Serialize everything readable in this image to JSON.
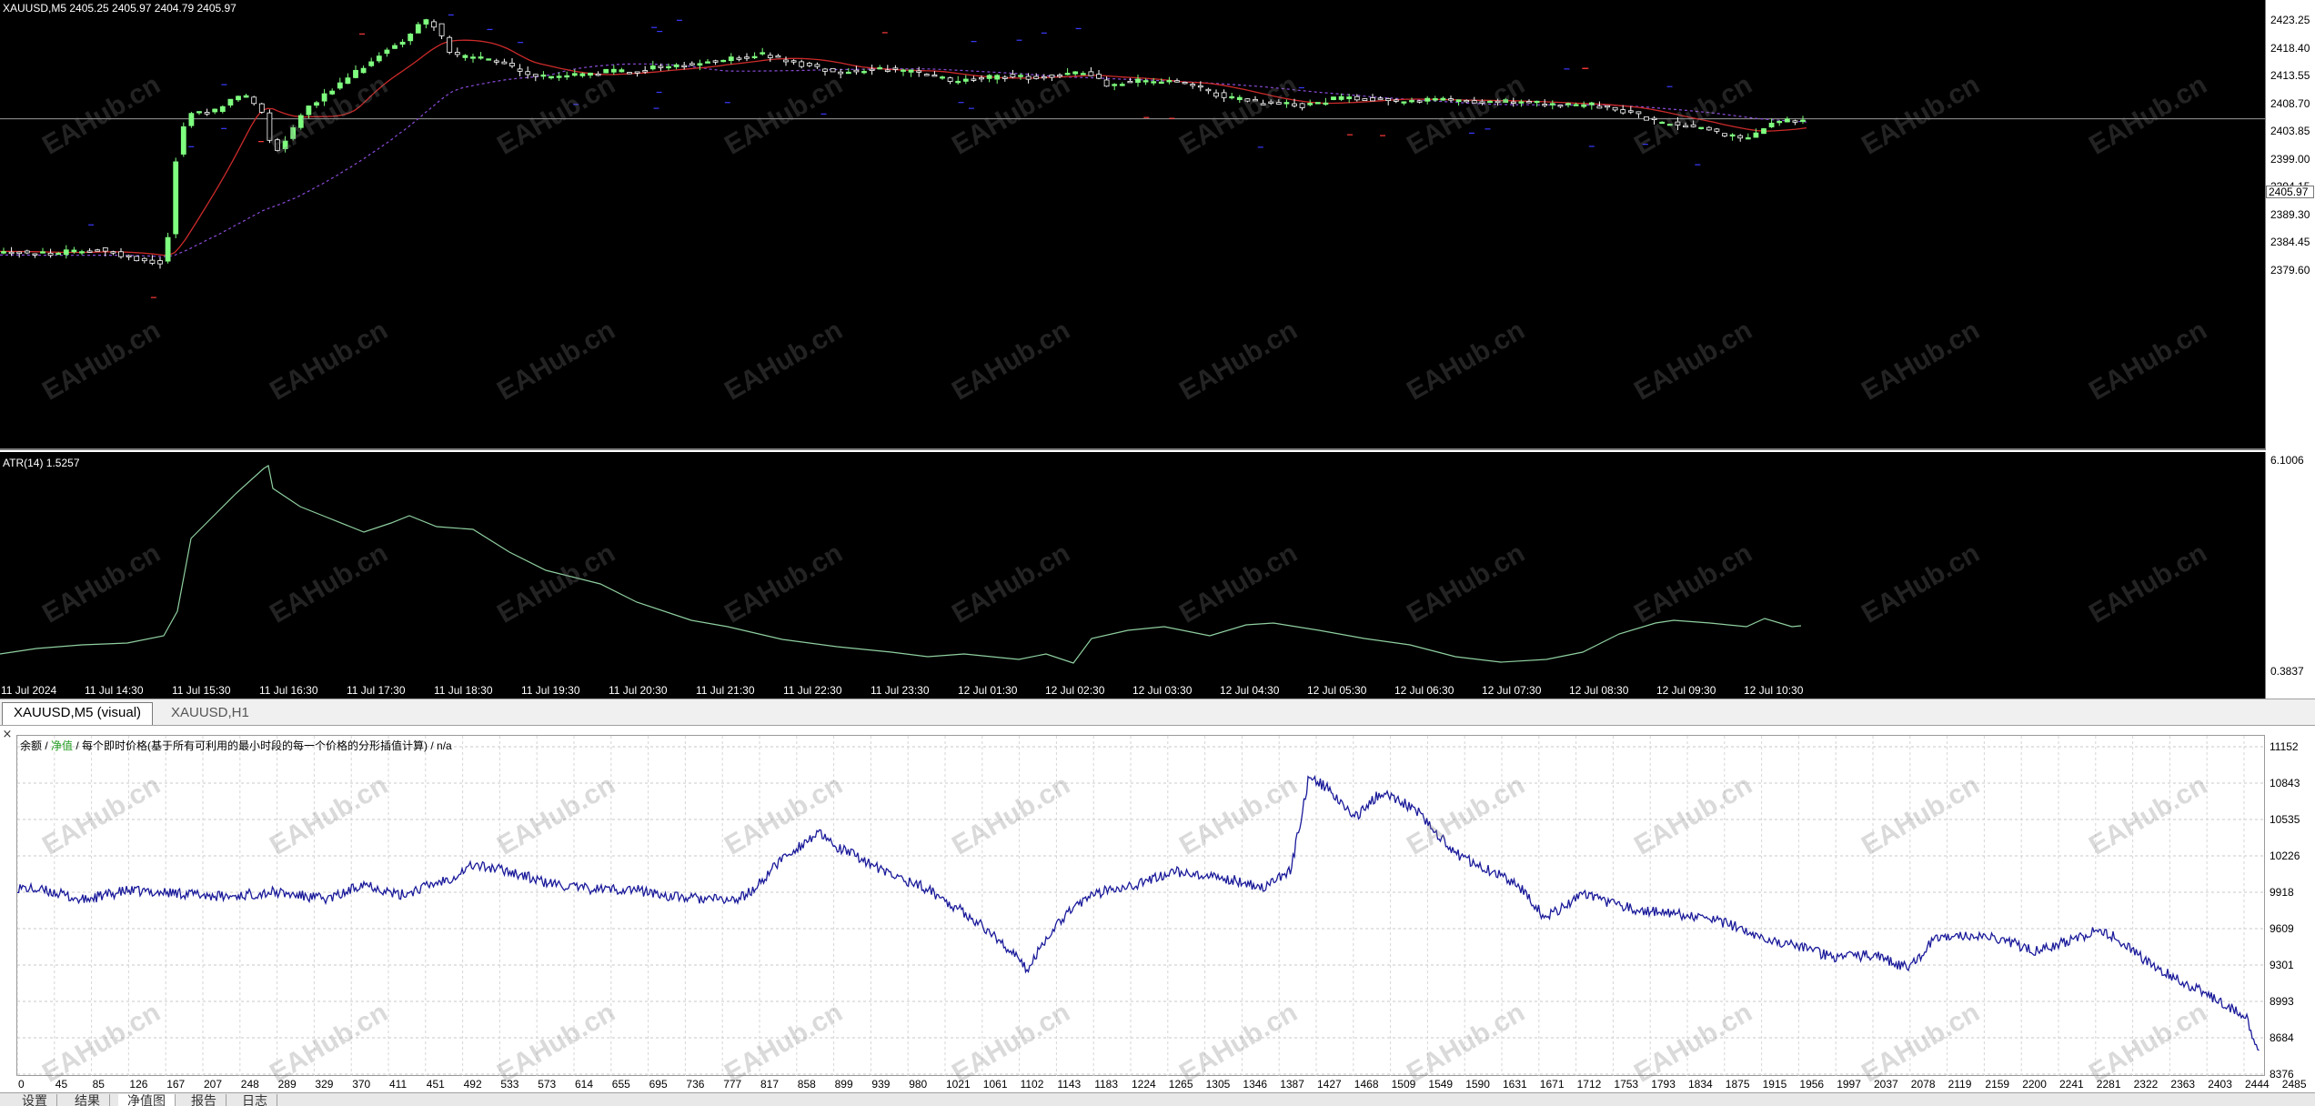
{
  "symbol_info": "XAUUSD,M5  2405.25 2405.97 2404.79 2405.97",
  "atr_info": "ATR(14) 1.5257",
  "current_price": "2405.97",
  "price_axis": [
    "2423.25",
    "2418.40",
    "2413.55",
    "2408.70",
    "2403.85",
    "2399.00",
    "2394.15",
    "2389.30",
    "2384.45",
    "2379.60"
  ],
  "atr_axis": [
    "6.1006",
    "0.3837"
  ],
  "time_axis": [
    "11 Jul 2024",
    "11 Jul 14:30",
    "11 Jul 15:30",
    "11 Jul 16:30",
    "11 Jul 17:30",
    "11 Jul 18:30",
    "11 Jul 19:30",
    "11 Jul 20:30",
    "11 Jul 21:30",
    "11 Jul 22:30",
    "11 Jul 23:30",
    "12 Jul 01:30",
    "12 Jul 02:30",
    "12 Jul 03:30",
    "12 Jul 04:30",
    "12 Jul 05:30",
    "12 Jul 06:30",
    "12 Jul 07:30",
    "12 Jul 08:30",
    "12 Jul 09:30",
    "12 Jul 10:30"
  ],
  "chart_tabs": [
    {
      "label": "XAUUSD,M5 (visual)"
    },
    {
      "label": "XAUUSD,H1"
    }
  ],
  "equity_legend": {
    "balance": "余额",
    "sep1": " / ",
    "equity": "净值",
    "rest": " / 每个即时价格(基于所有可利用的最小时段的每一个价格的分形插值计算) / n/a"
  },
  "equity_axis": [
    "11152",
    "10843",
    "10535",
    "10226",
    "9918",
    "9609",
    "9301",
    "8993",
    "8684",
    "8376"
  ],
  "equity_xaxis": [
    "0",
    "45",
    "85",
    "126",
    "167",
    "207",
    "248",
    "289",
    "329",
    "370",
    "411",
    "451",
    "492",
    "533",
    "573",
    "614",
    "655",
    "695",
    "736",
    "777",
    "817",
    "858",
    "899",
    "939",
    "980",
    "1021",
    "1061",
    "1102",
    "1143",
    "1183",
    "1224",
    "1265",
    "1305",
    "1346",
    "1387",
    "1427",
    "1468",
    "1509",
    "1549",
    "1590",
    "1631",
    "1671",
    "1712",
    "1753",
    "1793",
    "1834",
    "1875",
    "1915",
    "1956",
    "1997",
    "2037",
    "2078",
    "2119",
    "2159",
    "2200",
    "2241",
    "2281",
    "2322",
    "2363",
    "2403",
    "2444",
    "2485"
  ],
  "bottom_tabs": [
    {
      "label": "设置"
    },
    {
      "label": "结果"
    },
    {
      "label": "净值图"
    },
    {
      "label": "报告"
    },
    {
      "label": "日志"
    }
  ],
  "watermark": "EAHub.cn",
  "colors": {
    "bull_candle": "#7fff7f",
    "bear_candle": "#ffffff",
    "ma_red": "#cc2a2a",
    "ma_purple": "#8a4bd8",
    "atr_line": "#8fd0a0",
    "equity_line": "#1a1a9a",
    "balance_line": "#2a9a2a"
  }
}
